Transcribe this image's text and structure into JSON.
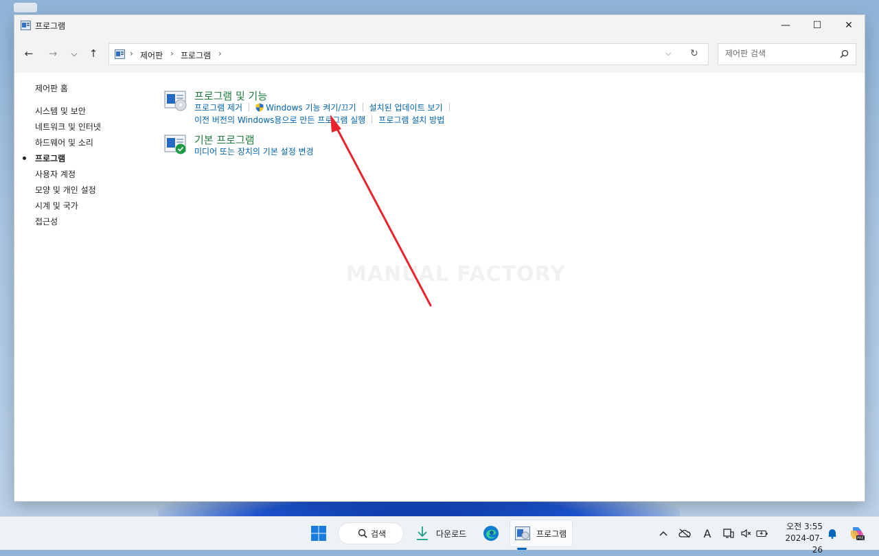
{
  "window": {
    "title": "프로그램",
    "minimize_glyph": "—",
    "maximize_glyph": "☐",
    "close_glyph": "✕"
  },
  "nav": {
    "back_glyph": "←",
    "forward_glyph": "→",
    "recent_glyph": "⌵",
    "up_glyph": "↑",
    "breadcrumbs": [
      "제어판",
      "프로그램"
    ],
    "crumb_separator": "›",
    "dropdown_glyph": "⌵",
    "refresh_glyph": "↻"
  },
  "search": {
    "placeholder": "제어판 검색"
  },
  "sidebar": {
    "items": [
      {
        "label": "제어판 홈"
      },
      {
        "label": "시스템 및 보안"
      },
      {
        "label": "네트워크 및 인터넷"
      },
      {
        "label": "하드웨어 및 소리"
      },
      {
        "label": "프로그램",
        "active": true
      },
      {
        "label": "사용자 계정"
      },
      {
        "label": "모양 및 개인 설정"
      },
      {
        "label": "시계 및 국가"
      },
      {
        "label": "접근성"
      }
    ]
  },
  "categories": [
    {
      "title": "프로그램 및 기능",
      "links_row1": [
        "프로그램 제거",
        "Windows 기능 켜기/끄기",
        "설치된 업데이트 보기"
      ],
      "links_row2": [
        "이전 버전의 Windows용으로 만든 프로그램 실행",
        "프로그램 설치 방법"
      ]
    },
    {
      "title": "기본 프로그램",
      "links_row1": [
        "미디어 또는 장치의 기본 설정 변경"
      ]
    }
  ],
  "watermark": "MANUAL FACTORY",
  "annotation": {
    "color": "#e8232b",
    "points_to": "이전 버전의 Windows용으로 만든 프로그램 실행"
  },
  "taskbar": {
    "search_label": "검색",
    "downloads_label": "다운로드",
    "active_app_label": "프로그램",
    "tray_ime_glyph": "A",
    "clock_time": "오전 3:55",
    "clock_date": "2024-07-26"
  },
  "colors": {
    "link": "#0063b1",
    "category_title": "#1e7d3a",
    "accent": "#0067c0"
  }
}
